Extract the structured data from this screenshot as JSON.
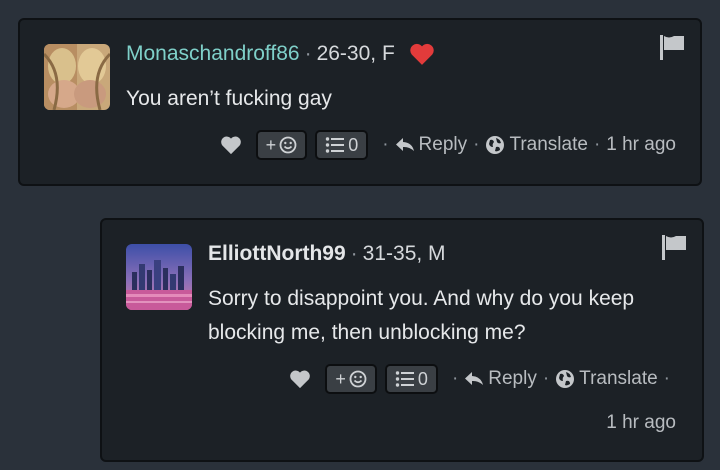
{
  "comments": [
    {
      "username": "Monaschandroff86",
      "separator": "·",
      "age_gender": "26-30, F",
      "text": "You aren’t fucking gay",
      "emoji_button_label": "+",
      "list_count": "0",
      "reply_label": "Reply",
      "translate_label": "Translate",
      "time": "1 hr ago",
      "liked_heart_color": "#e23b3b"
    },
    {
      "username": "ElliottNorth99",
      "separator": "·",
      "age_gender": "31-35, M",
      "text": "Sorry to disappoint you. And why do you keep blocking me, then unblocking me?",
      "emoji_button_label": "+",
      "list_count": "0",
      "reply_label": "Reply",
      "translate_label": "Translate",
      "time": "1 hr ago"
    }
  ],
  "icons": [
    "flag-icon",
    "heart-icon",
    "smiley-icon",
    "list-icon",
    "reply-arrow-icon",
    "globe-icon"
  ]
}
